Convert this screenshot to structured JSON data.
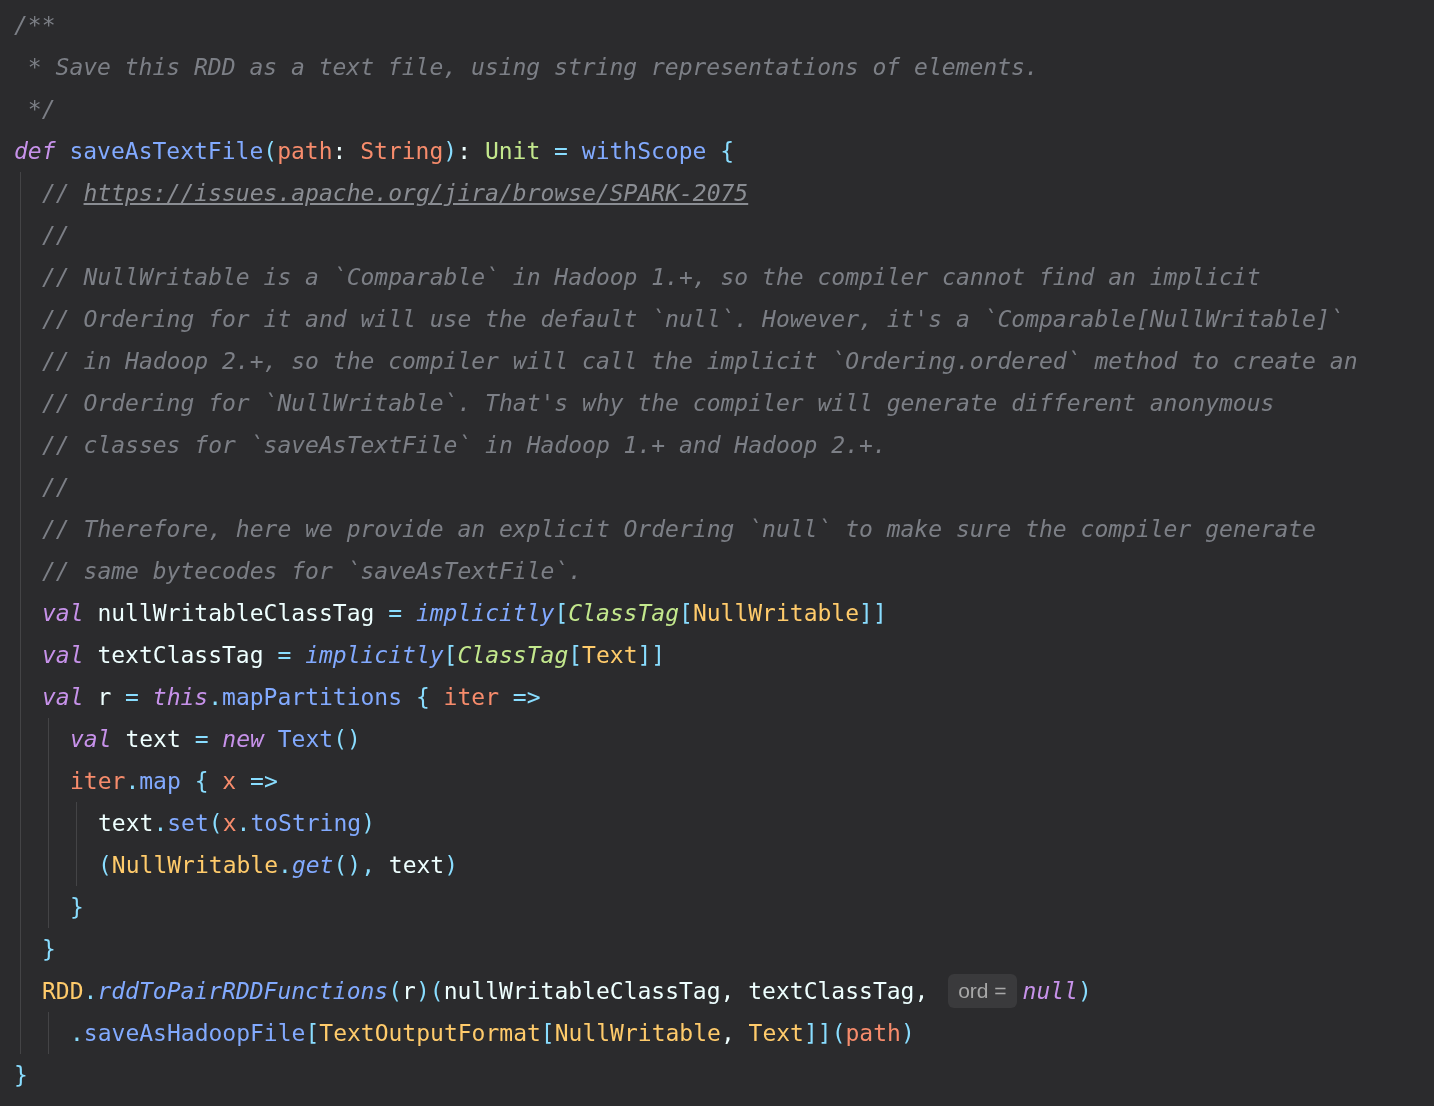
{
  "code": [
    {
      "tokens": [
        {
          "text": "/**",
          "kind": "comment"
        }
      ]
    },
    {
      "tokens": [
        {
          "text": " * Save this RDD as a text file, using string representations of elements.",
          "kind": "comment"
        }
      ]
    },
    {
      "tokens": [
        {
          "text": " */",
          "kind": "comment"
        }
      ]
    },
    {
      "tokens": [
        {
          "text": "def",
          "kind": "keyword"
        },
        {
          "text": " saveAsTextFile",
          "kind": "function"
        },
        {
          "text": "(",
          "kind": "punct"
        },
        {
          "text": "path",
          "kind": "param"
        },
        {
          "text": ": ",
          "kind": "plain"
        },
        {
          "text": "String",
          "kind": "param"
        },
        {
          "text": ")",
          "kind": "punct"
        },
        {
          "text": ": ",
          "kind": "plain"
        },
        {
          "text": "Unit",
          "kind": "green"
        },
        {
          "text": " = ",
          "kind": "punct"
        },
        {
          "text": "withScope",
          "kind": "function"
        },
        {
          "text": " {",
          "kind": "punct"
        }
      ],
      "children": [
        {
          "tokens": [
            {
              "text": "// ",
              "kind": "comment"
            },
            {
              "text": "https://issues.apache.org/jira/browse/SPARK-2075",
              "kind": "link"
            }
          ]
        },
        {
          "tokens": [
            {
              "text": "//",
              "kind": "comment"
            }
          ]
        },
        {
          "tokens": [
            {
              "text": "// NullWritable is a `Comparable` in Hadoop 1.+, so the compiler cannot find an implicit",
              "kind": "comment"
            }
          ]
        },
        {
          "tokens": [
            {
              "text": "// Ordering for it and will use the default `null`. However, it's a `Comparable[NullWritable]`",
              "kind": "comment"
            }
          ]
        },
        {
          "tokens": [
            {
              "text": "// in Hadoop 2.+, so the compiler will call the implicit `Ordering.ordered` method to create an",
              "kind": "comment"
            }
          ]
        },
        {
          "tokens": [
            {
              "text": "// Ordering for `NullWritable`. That's why the compiler will generate different anonymous",
              "kind": "comment"
            }
          ]
        },
        {
          "tokens": [
            {
              "text": "// classes for `saveAsTextFile` in Hadoop 1.+ and Hadoop 2.+.",
              "kind": "comment"
            }
          ]
        },
        {
          "tokens": [
            {
              "text": "//",
              "kind": "comment"
            }
          ]
        },
        {
          "tokens": [
            {
              "text": "// Therefore, here we provide an explicit Ordering `null` to make sure the compiler generate",
              "kind": "comment"
            }
          ]
        },
        {
          "tokens": [
            {
              "text": "// same bytecodes for `saveAsTextFile`.",
              "kind": "comment"
            }
          ]
        },
        {
          "tokens": [
            {
              "text": "val",
              "kind": "keyword"
            },
            {
              "text": " nullWritableClassTag ",
              "kind": "plain"
            },
            {
              "text": "= ",
              "kind": "punct"
            },
            {
              "text": "implicitly",
              "kind": "function_italic"
            },
            {
              "text": "[",
              "kind": "punct"
            },
            {
              "text": "ClassTag",
              "kind": "green_italic"
            },
            {
              "text": "[",
              "kind": "punct"
            },
            {
              "text": "NullWritable",
              "kind": "type"
            },
            {
              "text": "]]",
              "kind": "punct"
            }
          ]
        },
        {
          "tokens": [
            {
              "text": "val",
              "kind": "keyword"
            },
            {
              "text": " textClassTag ",
              "kind": "plain"
            },
            {
              "text": "= ",
              "kind": "punct"
            },
            {
              "text": "implicitly",
              "kind": "function_italic"
            },
            {
              "text": "[",
              "kind": "punct"
            },
            {
              "text": "ClassTag",
              "kind": "green_italic"
            },
            {
              "text": "[",
              "kind": "punct"
            },
            {
              "text": "Text",
              "kind": "type"
            },
            {
              "text": "]]",
              "kind": "punct"
            }
          ]
        },
        {
          "tokens": [
            {
              "text": "val",
              "kind": "keyword"
            },
            {
              "text": " r ",
              "kind": "plain"
            },
            {
              "text": "= ",
              "kind": "punct"
            },
            {
              "text": "this",
              "kind": "keyword"
            },
            {
              "text": ".",
              "kind": "punct"
            },
            {
              "text": "mapPartitions",
              "kind": "function"
            },
            {
              "text": " { ",
              "kind": "punct"
            },
            {
              "text": "iter",
              "kind": "param"
            },
            {
              "text": " =>",
              "kind": "punct"
            }
          ],
          "children": [
            {
              "tokens": [
                {
                  "text": "val",
                  "kind": "keyword"
                },
                {
                  "text": " text ",
                  "kind": "plain"
                },
                {
                  "text": "= ",
                  "kind": "punct"
                },
                {
                  "text": "new",
                  "kind": "keyword"
                },
                {
                  "text": " Text",
                  "kind": "function"
                },
                {
                  "text": "()",
                  "kind": "punct"
                }
              ]
            },
            {
              "tokens": [
                {
                  "text": "iter",
                  "kind": "param"
                },
                {
                  "text": ".",
                  "kind": "punct"
                },
                {
                  "text": "map",
                  "kind": "function"
                },
                {
                  "text": " { ",
                  "kind": "punct"
                },
                {
                  "text": "x",
                  "kind": "param"
                },
                {
                  "text": " =>",
                  "kind": "punct"
                }
              ],
              "children": [
                {
                  "tokens": [
                    {
                      "text": "text",
                      "kind": "plain"
                    },
                    {
                      "text": ".",
                      "kind": "punct"
                    },
                    {
                      "text": "set",
                      "kind": "function"
                    },
                    {
                      "text": "(",
                      "kind": "punct"
                    },
                    {
                      "text": "x",
                      "kind": "param"
                    },
                    {
                      "text": ".",
                      "kind": "punct"
                    },
                    {
                      "text": "toString",
                      "kind": "function"
                    },
                    {
                      "text": ")",
                      "kind": "punct"
                    }
                  ]
                },
                {
                  "tokens": [
                    {
                      "text": "(",
                      "kind": "punct"
                    },
                    {
                      "text": "NullWritable",
                      "kind": "type"
                    },
                    {
                      "text": ".",
                      "kind": "punct"
                    },
                    {
                      "text": "get",
                      "kind": "function_italic"
                    },
                    {
                      "text": "(), ",
                      "kind": "punct"
                    },
                    {
                      "text": "text",
                      "kind": "plain"
                    },
                    {
                      "text": ")",
                      "kind": "punct"
                    }
                  ]
                }
              ]
            },
            {
              "tokens": [
                {
                  "text": "}",
                  "kind": "punct"
                }
              ]
            }
          ]
        },
        {
          "tokens": [
            {
              "text": "}",
              "kind": "punct"
            }
          ]
        },
        {
          "tokens": [
            {
              "text": "RDD",
              "kind": "type"
            },
            {
              "text": ".",
              "kind": "punct"
            },
            {
              "text": "rddToPairRDDFunctions",
              "kind": "function_italic"
            },
            {
              "text": "(",
              "kind": "punct"
            },
            {
              "text": "r",
              "kind": "plain"
            },
            {
              "text": ")(",
              "kind": "punct"
            },
            {
              "text": "nullWritableClassTag, textClassTag, ",
              "kind": "plain"
            },
            {
              "text": "ord =",
              "kind": "hint"
            },
            {
              "text": "null",
              "kind": "keyword"
            },
            {
              "text": ")",
              "kind": "punct"
            }
          ],
          "children": [
            {
              "tokens": [
                {
                  "text": ".",
                  "kind": "punct"
                },
                {
                  "text": "saveAsHadoopFile",
                  "kind": "function"
                },
                {
                  "text": "[",
                  "kind": "punct"
                },
                {
                  "text": "TextOutputFormat",
                  "kind": "type"
                },
                {
                  "text": "[",
                  "kind": "punct"
                },
                {
                  "text": "NullWritable",
                  "kind": "type"
                },
                {
                  "text": ", ",
                  "kind": "plain"
                },
                {
                  "text": "Text",
                  "kind": "type"
                },
                {
                  "text": "]](",
                  "kind": "punct"
                },
                {
                  "text": "path",
                  "kind": "param"
                },
                {
                  "text": ")",
                  "kind": "punct"
                }
              ]
            }
          ]
        }
      ]
    },
    {
      "tokens": [
        {
          "text": "}",
          "kind": "punct"
        }
      ]
    }
  ]
}
